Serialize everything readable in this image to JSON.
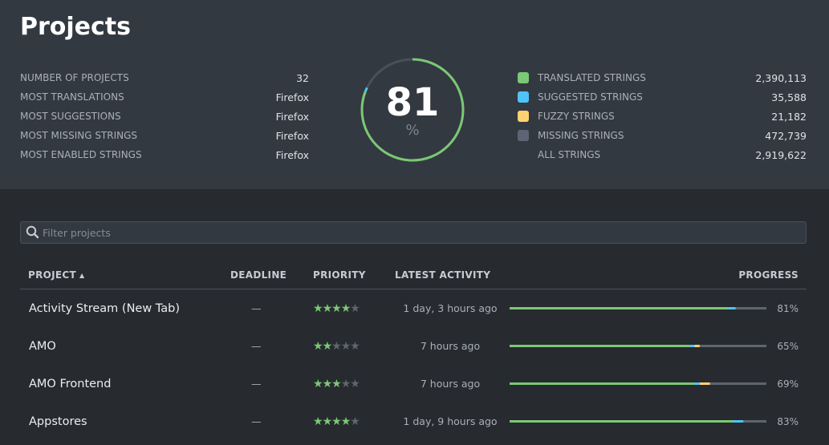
{
  "header": {
    "title": "Projects"
  },
  "stats_left": [
    {
      "label": "NUMBER OF PROJECTS",
      "value": "32"
    },
    {
      "label": "MOST TRANSLATIONS",
      "value": "Firefox"
    },
    {
      "label": "MOST SUGGESTIONS",
      "value": "Firefox"
    },
    {
      "label": "MOST MISSING STRINGS",
      "value": "Firefox"
    },
    {
      "label": "MOST ENABLED STRINGS",
      "value": "Firefox"
    }
  ],
  "overall": {
    "percent": "81",
    "unit": "%",
    "translated_fraction": 0.81,
    "suggested_fraction": 0.012
  },
  "stats_right": [
    {
      "label": "TRANSLATED STRINGS",
      "value": "2,390,113",
      "color": "#7bc876"
    },
    {
      "label": "SUGGESTED STRINGS",
      "value": "35,588",
      "color": "#4fc4f6"
    },
    {
      "label": "FUZZY STRINGS",
      "value": "21,182",
      "color": "#fed271"
    },
    {
      "label": "MISSING STRINGS",
      "value": "472,739",
      "color": "#5e6475"
    },
    {
      "label": "ALL STRINGS",
      "value": "2,919,622",
      "color": ""
    }
  ],
  "filter": {
    "placeholder": "Filter projects"
  },
  "table": {
    "headers": {
      "project": "PROJECT",
      "deadline": "DEADLINE",
      "priority": "PRIORITY",
      "activity": "LATEST ACTIVITY",
      "progress": "PROGRESS"
    },
    "sort_icon": "caret-up-icon",
    "rows": [
      {
        "name": "Activity Stream (New Tab)",
        "deadline": "—",
        "priority": 4,
        "activity": "1 day, 3 hours ago",
        "translated": 0.85,
        "suggested": 0.03,
        "fuzzy": 0.0,
        "percent": "81%"
      },
      {
        "name": "AMO",
        "deadline": "—",
        "priority": 2,
        "activity": "7 hours ago",
        "translated": 0.7,
        "suggested": 0.02,
        "fuzzy": 0.02,
        "percent": "65%"
      },
      {
        "name": "AMO Frontend",
        "deadline": "—",
        "priority": 3,
        "activity": "7 hours ago",
        "translated": 0.72,
        "suggested": 0.02,
        "fuzzy": 0.04,
        "percent": "69%"
      },
      {
        "name": "Appstores",
        "deadline": "—",
        "priority": 4,
        "activity": "1 day, 9 hours ago",
        "translated": 0.87,
        "suggested": 0.04,
        "fuzzy": 0.0,
        "percent": "83%"
      }
    ]
  },
  "colors": {
    "translated": "#7bc876",
    "suggested": "#4fc4f6",
    "fuzzy": "#fed271",
    "missing": "#5e656d",
    "star_on": "#7bc876",
    "star_off": "#5e656d"
  }
}
